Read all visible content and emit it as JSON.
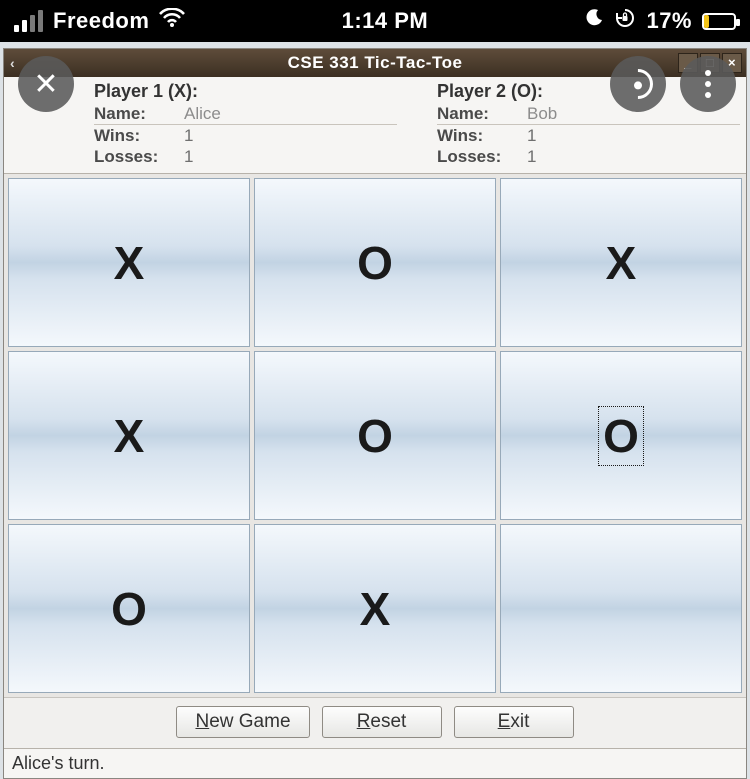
{
  "phone": {
    "carrier": "Freedom",
    "time": "1:14 PM",
    "battery_pct": "17%",
    "battery_fill_pct": 17
  },
  "window": {
    "title": "CSE 331 Tic-Tac-Toe"
  },
  "players": {
    "p1": {
      "heading": "Player 1 (X):",
      "name_label": "Name:",
      "name_value": "Alice",
      "wins_label": "Wins:",
      "wins_value": "1",
      "losses_label": "Losses:",
      "losses_value": "1"
    },
    "p2": {
      "heading": "Player 2 (O):",
      "name_label": "Name:",
      "name_value": "Bob",
      "wins_label": "Wins:",
      "wins_value": "1",
      "losses_label": "Losses:",
      "losses_value": "1"
    }
  },
  "board": {
    "cells": [
      "X",
      "O",
      "X",
      "X",
      "O",
      "O",
      "O",
      "X",
      ""
    ],
    "last_move_index": 5
  },
  "buttons": {
    "new_game": {
      "mnemonic": "N",
      "rest": "ew Game"
    },
    "reset": {
      "mnemonic": "R",
      "rest": "eset"
    },
    "exit": {
      "mnemonic": "E",
      "rest": "xit"
    }
  },
  "status": "Alice's turn."
}
